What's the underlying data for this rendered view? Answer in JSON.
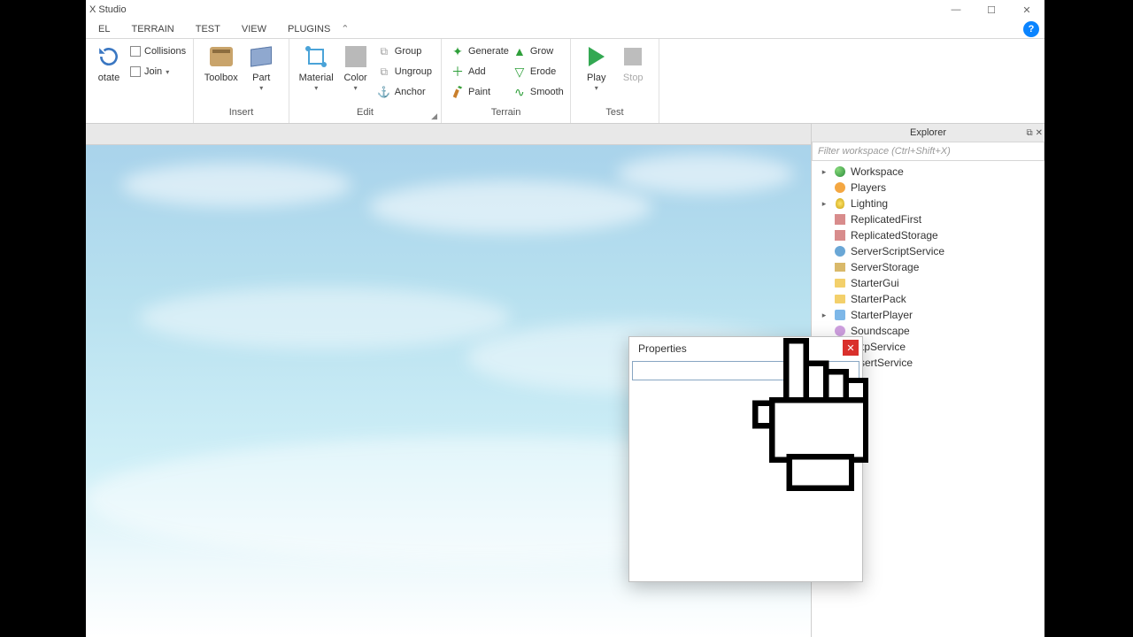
{
  "title": "X Studio",
  "menubar": {
    "items": [
      "EL",
      "TERRAIN",
      "TEST",
      "VIEW",
      "PLUGINS"
    ]
  },
  "ribbon": {
    "group0": {
      "rotate": "otate",
      "collisions": "Collisions",
      "join": "Join"
    },
    "insert": {
      "label": "Insert",
      "toolbox": "Toolbox",
      "part": "Part"
    },
    "edit": {
      "label": "Edit",
      "material": "Material",
      "color": "Color",
      "group": "Group",
      "ungroup": "Ungroup",
      "anchor": "Anchor"
    },
    "terrain": {
      "label": "Terrain",
      "generate": "Generate",
      "grow": "Grow",
      "add": "Add",
      "erode": "Erode",
      "paint": "Paint",
      "smooth": "Smooth"
    },
    "test": {
      "label": "Test",
      "play": "Play",
      "stop": "Stop"
    }
  },
  "explorer": {
    "title": "Explorer",
    "filter_placeholder": "Filter workspace (Ctrl+Shift+X)",
    "items": [
      {
        "label": "Workspace",
        "icon": "globe",
        "expandable": true
      },
      {
        "label": "Players",
        "icon": "players",
        "expandable": false
      },
      {
        "label": "Lighting",
        "icon": "light",
        "expandable": true
      },
      {
        "label": "ReplicatedFirst",
        "icon": "rep",
        "expandable": false
      },
      {
        "label": "ReplicatedStorage",
        "icon": "rep",
        "expandable": false
      },
      {
        "label": "ServerScriptService",
        "icon": "gear",
        "expandable": false
      },
      {
        "label": "ServerStorage",
        "icon": "box",
        "expandable": false
      },
      {
        "label": "StarterGui",
        "icon": "folder",
        "expandable": false
      },
      {
        "label": "StarterPack",
        "icon": "folder",
        "expandable": false
      },
      {
        "label": "StarterPlayer",
        "icon": "player",
        "expandable": true
      },
      {
        "label": "Soundscape",
        "icon": "sound",
        "expandable": false
      },
      {
        "label": "HttpService",
        "icon": "gear",
        "expandable": false
      },
      {
        "label": "InsertService",
        "icon": "gear",
        "expandable": false
      }
    ]
  },
  "properties": {
    "title": "Properties"
  }
}
